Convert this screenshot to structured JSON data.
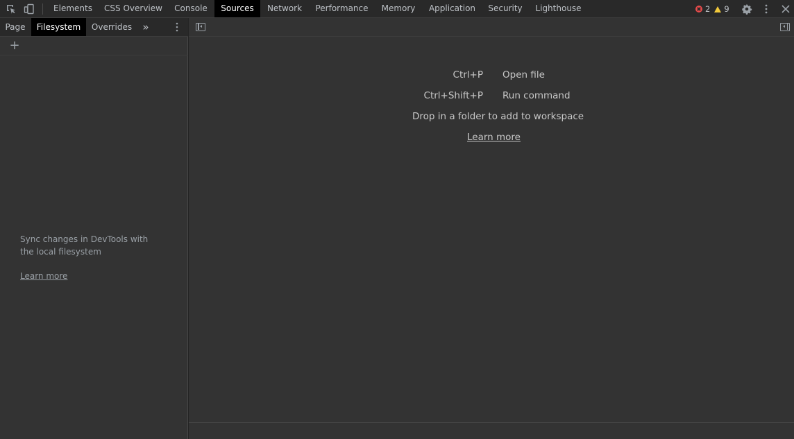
{
  "main_tabs": [
    {
      "label": "Elements"
    },
    {
      "label": "CSS Overview"
    },
    {
      "label": "Console"
    },
    {
      "label": "Sources"
    },
    {
      "label": "Network"
    },
    {
      "label": "Performance"
    },
    {
      "label": "Memory"
    },
    {
      "label": "Application"
    },
    {
      "label": "Security"
    },
    {
      "label": "Lighthouse"
    }
  ],
  "active_main_tab": "Sources",
  "counters": {
    "errors": "2",
    "warnings": "9"
  },
  "navigator": {
    "tabs": [
      {
        "label": "Page"
      },
      {
        "label": "Filesystem"
      },
      {
        "label": "Overrides"
      }
    ],
    "active_tab": "Filesystem",
    "more_label": "»",
    "add_label": "+",
    "empty_message": "Sync changes in DevTools with the local filesystem",
    "learn_more": "Learn more"
  },
  "editor": {
    "shortcuts": [
      {
        "keys": "Ctrl+P",
        "action": "Open file"
      },
      {
        "keys": "Ctrl+Shift+P",
        "action": "Run command"
      }
    ],
    "drop_text": "Drop in a folder to add to workspace",
    "learn_more": "Learn more"
  },
  "colors": {
    "active_tab_bg": "#000000",
    "panel_bg": "#333333",
    "toolbar_bg": "#292929",
    "error": "#e94b4b",
    "warning": "#f2c93b"
  },
  "icons": [
    "inspect-element-icon",
    "device-toolbar-icon",
    "error-icon",
    "warning-icon",
    "settings-gear-icon",
    "kebab-menu-icon",
    "close-icon",
    "toggle-navigator-icon",
    "toggle-debugger-icon",
    "add-folder-icon",
    "more-tabs-icon"
  ]
}
